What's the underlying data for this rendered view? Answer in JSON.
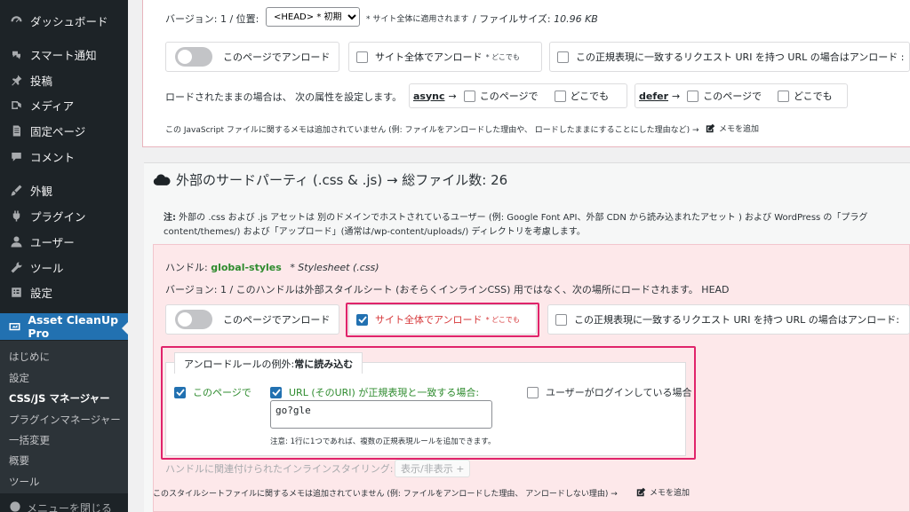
{
  "sidebar": {
    "items": [
      {
        "label": "ダッシュボード",
        "icon": "dashboard-icon"
      },
      {
        "label": "スマート通知",
        "icon": "notification-icon"
      },
      {
        "label": "投稿",
        "icon": "pin-icon"
      },
      {
        "label": "メディア",
        "icon": "media-icon"
      },
      {
        "label": "固定ページ",
        "icon": "page-icon"
      },
      {
        "label": "コメント",
        "icon": "comment-icon"
      },
      {
        "label": "外観",
        "icon": "brush-icon"
      },
      {
        "label": "プラグイン",
        "icon": "plugin-icon"
      },
      {
        "label": "ユーザー",
        "icon": "user-icon"
      },
      {
        "label": "ツール",
        "icon": "wrench-icon"
      },
      {
        "label": "設定",
        "icon": "settings-icon"
      }
    ],
    "active": {
      "label": "Asset CleanUp Pro",
      "icon": "asset-cleanup-icon"
    },
    "submenu": [
      "はじめに",
      "設定",
      "CSS/JS マネージャー",
      "プラグインマネージャー",
      "一括変更",
      "概要",
      "ツール"
    ],
    "collapse_label": "メニューを閉じる"
  },
  "top_asset": {
    "version_text": "バージョン: 1 /  位置:",
    "position_value": "<HEAD> * 初期",
    "sitewide_note": "* サイト全体に適用されます",
    "filesize_label": "/  ファイルサイズ: ",
    "filesize_value": "10.96 KB",
    "unload_page": "このページでアンロード",
    "unload_site": "サイト全体でアンロード",
    "unload_site_sup": "* どこでも",
    "unload_regex": "この正規表現に一致するリクエスト URI を持つ URL の場合はアンロード :",
    "attr_text": "ロードされたままの場合は、 次の属性を設定します。",
    "async_label": "async",
    "defer_label": "defer",
    "arrow": "→",
    "this_page": "このページで",
    "everywhere": "どこでも",
    "note_text": "この JavaScript ファイルに関するメモは追加されていません (例: ファイルをアンロードした理由や、 ロードしたままにすることにした理由など) →",
    "add_note": "メモを追加"
  },
  "section": {
    "title": "外部のサードパーティ (.css & .js) → 総ファイル数: 26",
    "note_bold": "注:",
    "note_text": " 外部の .css および .js アセットは 別のドメインでホストされているユーザー (例: Google Font API、外部 CDN から読み込まれたアセット ) および WordPress の「プラグ",
    "note_text2": "content/themes/) および「アップロード」(通常は/wp-content/uploads/) ディレクトリを考慮します。"
  },
  "asset": {
    "handle_label": "ハンドル:",
    "handle_value": "global-styles",
    "handle_type": "* Stylesheet (.css)",
    "version_text": "バージョン: 1 /  このハンドルは外部スタイルシート (おそらくインラインCSS) 用ではなく、次の場所にロードされます。 HEAD",
    "unload_page": "このページでアンロード",
    "unload_site": "サイト全体でアンロード",
    "unload_site_sup": "* どこでも",
    "unload_regex": "この正規表現に一致するリクエスト URI を持つ URL の場合はアンロード:",
    "exception_tab_prefix": "アンロードルールの例外: ",
    "exception_tab_bold": "常に読み込む",
    "exc_this_page": "このページで",
    "exc_regex": "URL (そのURI) が正規表現と一致する場合:",
    "regex_value": "go?gle",
    "exc_logged_in": "ユーザーがログインしている場合",
    "regex_note": "注意: 1行に1つであれば、複数の正規表現ルールを追加できます。",
    "inline_label": "ハンドルに関連付けられたインラインスタイリング:",
    "show_hide": "表示/非表示",
    "note_text": "このスタイルシートファイルに関するメモは追加されていません (例: ファイルをアンロードした理由、 アンロードしない理由) →",
    "add_note": "メモを追加"
  },
  "colors": {
    "sidebar_bg": "#1d2327",
    "active_bg": "#2271b1",
    "highlight": "#e0246b",
    "green": "#2e8b2e",
    "red_text": "#d63638"
  }
}
